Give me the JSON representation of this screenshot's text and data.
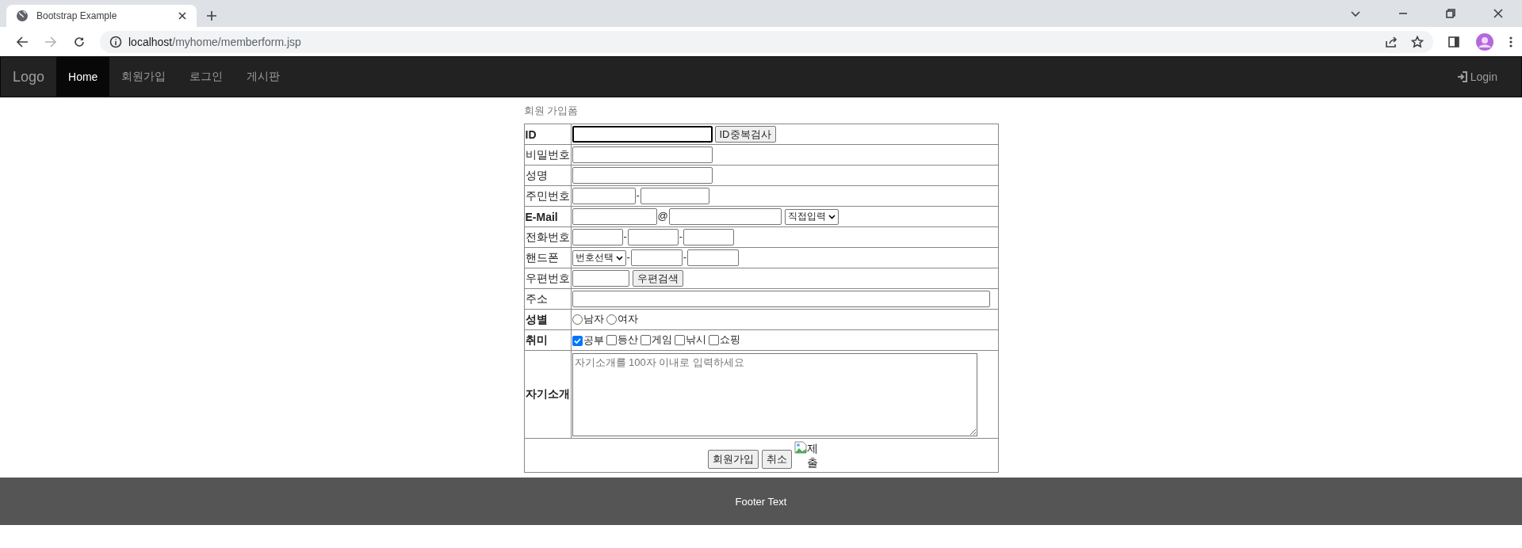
{
  "browser": {
    "tabs": [
      {
        "title": "Bootstrap Example",
        "selected": true
      }
    ],
    "url": "localhost/myhome/memberform.jsp"
  },
  "navbar": {
    "brand": "Logo",
    "items": [
      {
        "label": "Home",
        "selected": true
      },
      {
        "label": "회원가입",
        "selected": false
      },
      {
        "label": "로그인",
        "selected": false
      },
      {
        "label": "게시판",
        "selected": false
      }
    ],
    "login": "Login"
  },
  "form": {
    "title": "회원 가입폼",
    "rows": [
      {
        "label": "ID",
        "bold": true,
        "kind": "id",
        "focused": true,
        "button": "ID중복검사"
      },
      {
        "label": "비밀번호",
        "bold": false,
        "kind": "password"
      },
      {
        "label": "성명",
        "bold": false,
        "kind": "text"
      },
      {
        "label": "주민번호",
        "bold": false,
        "kind": "jumin",
        "separator": "-"
      },
      {
        "label": "E-Mail",
        "bold": true,
        "kind": "email",
        "at": "@",
        "select": "직접입력"
      },
      {
        "label": "전화번호",
        "bold": false,
        "kind": "phone",
        "separators": [
          "-",
          "-"
        ]
      },
      {
        "label": "핸드폰",
        "bold": false,
        "kind": "mobile",
        "select": "번호선택",
        "separators": [
          "-",
          "-"
        ]
      },
      {
        "label": "우편번호",
        "bold": false,
        "kind": "zip",
        "button": "우편검색"
      },
      {
        "label": "주소",
        "bold": false,
        "kind": "address"
      },
      {
        "label": "성별",
        "bold": true,
        "kind": "radio",
        "options": [
          {
            "label": "남자",
            "checked": false
          },
          {
            "label": "여자",
            "checked": false
          }
        ]
      },
      {
        "label": "취미",
        "bold": true,
        "kind": "checkbox",
        "options": [
          {
            "label": "공부",
            "checked": true
          },
          {
            "label": "등산",
            "checked": false
          },
          {
            "label": "게임",
            "checked": false
          },
          {
            "label": "낚시",
            "checked": false
          },
          {
            "label": "쇼핑",
            "checked": false
          }
        ]
      },
      {
        "label": "자기소개",
        "bold": true,
        "kind": "textarea",
        "placeholder": "자기소개를 100자 이내로 입력하세요"
      }
    ],
    "buttons": [
      "회원가입",
      "취소"
    ],
    "image_alt": "제출"
  },
  "footer": "Footer Text"
}
